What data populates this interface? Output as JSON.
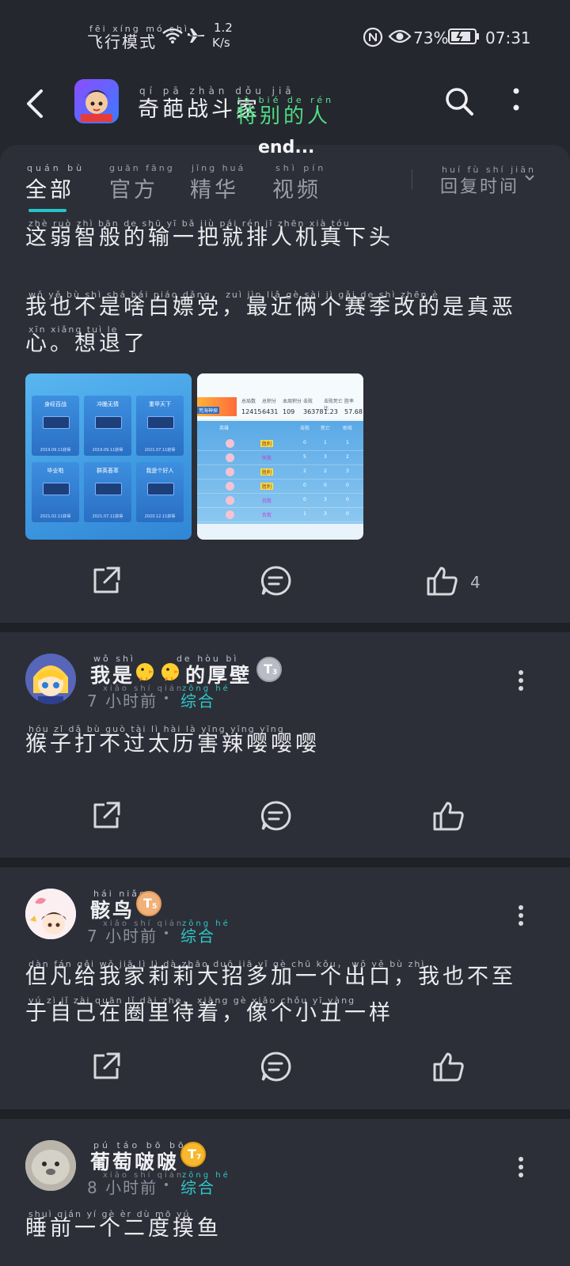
{
  "status_bar": {
    "airplane_mode_pinyin": "fēi xíng mó shì",
    "airplane_mode": "飞行模式",
    "speed_value": "1.2",
    "speed_unit": "K/s",
    "battery": "73%",
    "time": "07:31"
  },
  "header": {
    "title_pinyin": "qí pā zhàn dǒu jiā",
    "title": "奇葩战斗家",
    "overlay_pinyin": "tè bié de rén",
    "overlay": "特别的人",
    "marquee": "end..."
  },
  "tabs": [
    {
      "label": "全部",
      "pinyin": "quán bù"
    },
    {
      "label": "官方",
      "pinyin": "guān fāng"
    },
    {
      "label": "精华",
      "pinyin": "jīng huá"
    },
    {
      "label": "视频",
      "pinyin": "shì pín"
    }
  ],
  "sort": {
    "label": "回复时间",
    "pinyin": "huí fù shí jiān"
  },
  "main_post": {
    "line1_pinyin": "zhè ruò zhì bān de shū yī bǎ jiù pái rén jī zhēn xià tóu",
    "line1": "这弱智般的输一把就排人机真下头",
    "line2_pinyin": "wǒ yě bù shì shá bái piáo dǎng， zuì jìn liǎ gè sài jì gǎi de shì zhēn è",
    "line2": "我也不是啥白嫖党，最近俩个赛季改的是真恶",
    "line3_pinyin": "xīn  xiǎng tuì le",
    "line3": "心。想退了",
    "like_count": "4",
    "thumb1": {
      "cards": [
        "身经百战",
        "冲脆无情",
        "重甲天下",
        "毕业啦",
        "群英荟萃",
        "我是个好人"
      ],
      "dates": [
        "2019.09.11获得",
        "2019.09.11获得",
        "2021.07.11获得",
        "2021.02.11获得",
        "2021.07.11获得",
        "2020.12.11获得"
      ]
    },
    "thumb2": {
      "player": "荒海神探",
      "stat_headers": [
        "总局数",
        "总积分",
        "本周积分",
        "击败",
        "击败死亡比",
        "胜率"
      ],
      "stat_values": [
        "12415",
        "6431",
        "109",
        "36378",
        "1.23",
        "57.68"
      ],
      "table_headers": [
        "英雄",
        "击败",
        "死亡",
        "助攻"
      ],
      "rows": [
        {
          "result": "胜利",
          "k": "0",
          "d": "1",
          "a": "1"
        },
        {
          "result": "失败",
          "k": "5",
          "d": "3",
          "a": "2"
        },
        {
          "result": "胜利",
          "k": "2",
          "d": "2",
          "a": "3"
        },
        {
          "result": "胜利",
          "k": "0",
          "d": "0",
          "a": "0"
        },
        {
          "result": "白败",
          "k": "0",
          "d": "3",
          "a": "0"
        },
        {
          "result": "负败",
          "k": "1",
          "d": "3",
          "a": "0"
        }
      ]
    }
  },
  "comments": [
    {
      "name_pinyin": "wǒ shì        de hòu bì",
      "name_a": "我是",
      "name_b": "的厚壁",
      "badge": "T",
      "badge_level": "3",
      "time_pinyin": "xiǎo shí qián",
      "time": "7 小时前",
      "tag_pinyin": "zōng hé",
      "tag": "综合",
      "text_pinyin": "hóu zǐ dǎ bù guò tài lì hài là yīng yīng yīng",
      "text": "猴子打不过太历害辣嘤嘤嘤"
    },
    {
      "name_pinyin": "hái niǎo",
      "name": "骸鸟",
      "badge": "T",
      "badge_level": "5",
      "time_pinyin": "xiǎo shí qián",
      "time": "7 小时前",
      "tag_pinyin": "zōng hé",
      "tag": "综合",
      "text_pinyin1": "dàn fán gěi wǒ jiā lì lì dà zhāo duō jiā yī gè chū kǒu，  wǒ yě bù zhì",
      "text1": "但凡给我家莉莉大招多加一个出口，我也不至",
      "text_pinyin2": "yú zì jǐ zài quān lǐ dài zhe， xiàng gè xiǎo chǒu yī yàng",
      "text2": "于自己在圈里待着，像个小丑一样"
    },
    {
      "name_pinyin": "pú táo bō bō",
      "name": "葡萄啵啵",
      "badge": "T",
      "badge_level": "7",
      "time_pinyin": "xiǎo shí qián",
      "time": "8 小时前",
      "tag_pinyin": "zōng hé",
      "tag": "综合",
      "text_pinyin": "shuì qián yí gè èr dù mō yú",
      "text": "睡前一个二度摸鱼"
    }
  ]
}
